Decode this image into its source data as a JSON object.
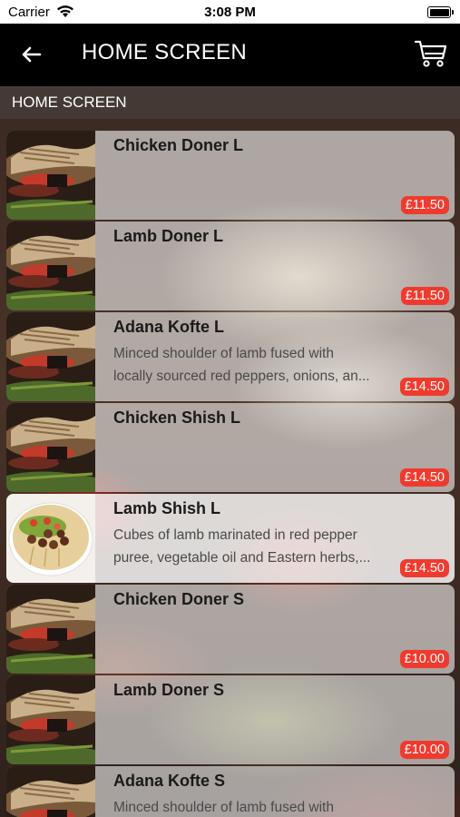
{
  "status_bar": {
    "carrier": "Carrier",
    "time": "3:08 PM"
  },
  "nav": {
    "title": "HOME SCREEN",
    "back_icon": "arrow-left-icon",
    "cart_icon": "cart-icon"
  },
  "section": {
    "title": "HOME SCREEN"
  },
  "colors": {
    "accent_price": "#f03a2e",
    "nav_bg": "#000000"
  },
  "items": [
    {
      "name": "Chicken Doner L",
      "desc1": "",
      "desc2": "",
      "price": "£11.50",
      "thumb": "kebab"
    },
    {
      "name": "Lamb Doner L",
      "desc1": "",
      "desc2": "",
      "price": "£11.50",
      "thumb": "kebab"
    },
    {
      "name": "Adana Kofte L",
      "desc1": "Minced shoulder of lamb fused with",
      "desc2": "locally sourced red peppers, onions, an...",
      "price": "£14.50",
      "thumb": "kebab"
    },
    {
      "name": "Chicken Shish L",
      "desc1": "",
      "desc2": "",
      "price": "£14.50",
      "thumb": "kebab"
    },
    {
      "name": "Lamb Shish L",
      "desc1": "Cubes of lamb marinated in red pepper",
      "desc2": "puree, vegetable oil and Eastern herbs,...",
      "price": "£14.50",
      "thumb": "plate"
    },
    {
      "name": "Chicken Doner S",
      "desc1": "",
      "desc2": "",
      "price": "£10.00",
      "thumb": "kebab"
    },
    {
      "name": "Lamb Doner S",
      "desc1": "",
      "desc2": "",
      "price": "£10.00",
      "thumb": "kebab"
    },
    {
      "name": "Adana Kofte S",
      "desc1": "Minced shoulder of lamb fused with",
      "desc2": "",
      "price": "",
      "thumb": "kebab"
    }
  ]
}
